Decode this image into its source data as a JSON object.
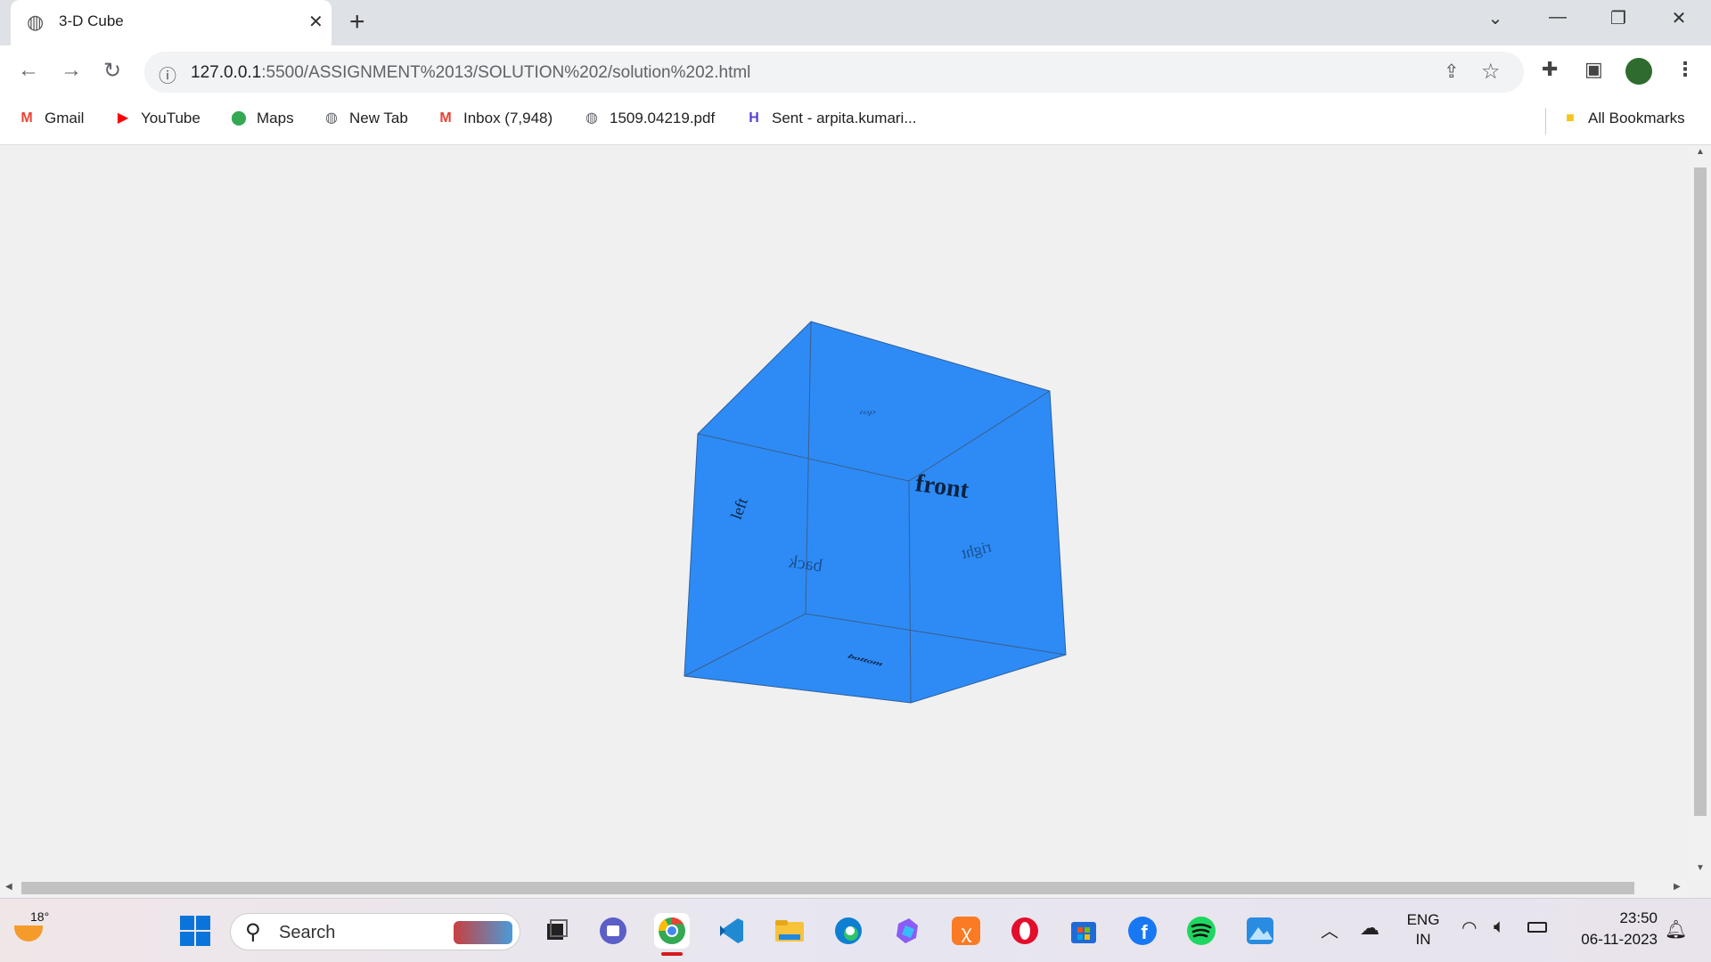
{
  "browser": {
    "tab_title": "3-D Cube",
    "tab_close": "✕",
    "new_tab": "+",
    "url_host": "127.0.0.1",
    "url_path": ":5500/ASSIGNMENT%2013/SOLUTION%202/solution%202.html"
  },
  "bookmarks": [
    {
      "label": "Gmail",
      "icon": "gmail-icon",
      "color": "#ea4335",
      "glyph": "M"
    },
    {
      "label": "YouTube",
      "icon": "youtube-icon",
      "color": "#ff0000",
      "glyph": "▶"
    },
    {
      "label": "Maps",
      "icon": "maps-icon",
      "color": "#34a853",
      "glyph": "⬤"
    },
    {
      "label": "New Tab",
      "icon": "globe-icon",
      "color": "#5f6368",
      "glyph": "◍"
    },
    {
      "label": "Inbox (7,948)",
      "icon": "gmail-icon",
      "color": "#ea4335",
      "glyph": "M"
    },
    {
      "label": "1509.04219.pdf",
      "icon": "globe-icon",
      "color": "#5f6368",
      "glyph": "◍"
    },
    {
      "label": "Sent - arpita.kumari...",
      "icon": "sent-app-icon",
      "color": "#5b3fd6",
      "glyph": "H"
    }
  ],
  "all_bookmarks": "All Bookmarks",
  "cube": {
    "face_color": "#2e8bf5",
    "labels": {
      "front": "front",
      "back": "back",
      "left": "left",
      "right": "right",
      "top": "top",
      "bottom": "bottom"
    }
  },
  "taskbar": {
    "weather_temp": "18°",
    "search_label": "Search",
    "language_top": "ENG",
    "language_bottom": "IN",
    "time": "23:50",
    "date": "06-11-2023"
  }
}
